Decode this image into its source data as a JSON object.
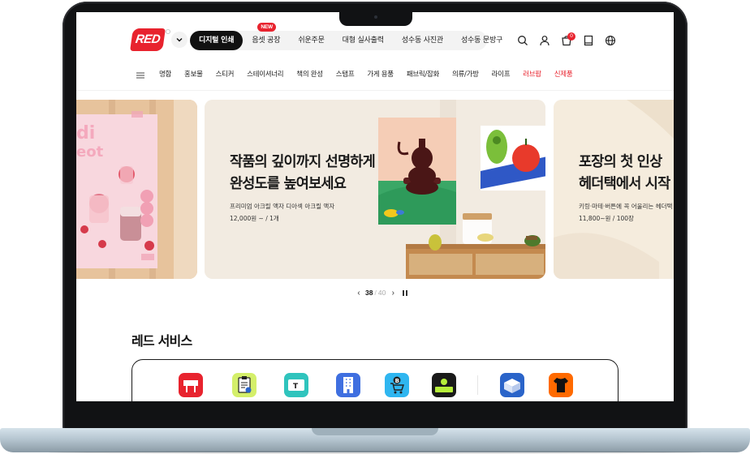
{
  "header": {
    "logo_text": "RED",
    "tabs": [
      {
        "label": "디지털 인쇄",
        "active": true
      },
      {
        "label": "음셋 공장",
        "badge": "NEW"
      },
      {
        "label": "쉬운주문"
      },
      {
        "label": "대형 실사출력"
      },
      {
        "label": "성수동 사진관"
      },
      {
        "label": "성수동 문방구"
      }
    ],
    "cart_count": "0",
    "icons": [
      "search-icon",
      "user-icon",
      "cart-icon",
      "book-icon",
      "globe-icon"
    ]
  },
  "nav": {
    "items": [
      {
        "label": "명함"
      },
      {
        "label": "홍보물"
      },
      {
        "label": "스티커"
      },
      {
        "label": "스테이셔너리"
      },
      {
        "label": "책의 완성"
      },
      {
        "label": "스탬프"
      },
      {
        "label": "가게 용품"
      },
      {
        "label": "패브릭/잡화"
      },
      {
        "label": "의류/가방"
      },
      {
        "label": "라이프"
      },
      {
        "label": "러브팝",
        "color": "#e8232e"
      },
      {
        "label": "신제품",
        "color": "#e8232e"
      }
    ]
  },
  "hero": {
    "center": {
      "title_line1": "작품의 깊이까지 선명하게",
      "title_line2": "완성도를 높여보세요",
      "subtitle": "프리미엄 아크릴 액자 디아섹 아크릴 액자",
      "price": "12,000원 ~ / 1개"
    },
    "right": {
      "title_line1": "포장의 첫 인상",
      "title_line2": "헤더택에서 시작",
      "subtitle": "키링·마테·버튼에 꼭 어울리는 헤더택",
      "price": "11,800~원 / 100장"
    },
    "pager": {
      "current": "38",
      "separator": "/",
      "total": "40"
    }
  },
  "services": {
    "title": "레드 서비스",
    "icons": [
      {
        "name": "signboard-icon",
        "color": "#e8232e"
      },
      {
        "name": "checklist-icon",
        "color": "#d4ef6a"
      },
      {
        "name": "ticket-icon",
        "color": "#2fc4bd"
      },
      {
        "name": "building-icon",
        "color": "#3f6fe0"
      },
      {
        "name": "shopping-cart-icon",
        "color": "#2fb6f0"
      },
      {
        "name": "today-delivery-icon",
        "color": "#1a1a1a",
        "text": "오늘출발"
      },
      {
        "name": "package-icon",
        "color": "#2a64c9"
      },
      {
        "name": "tshirt-icon",
        "color": "#ff6a00"
      }
    ]
  },
  "colors": {
    "brand": "#e8232e",
    "active_tab": "#111111"
  }
}
